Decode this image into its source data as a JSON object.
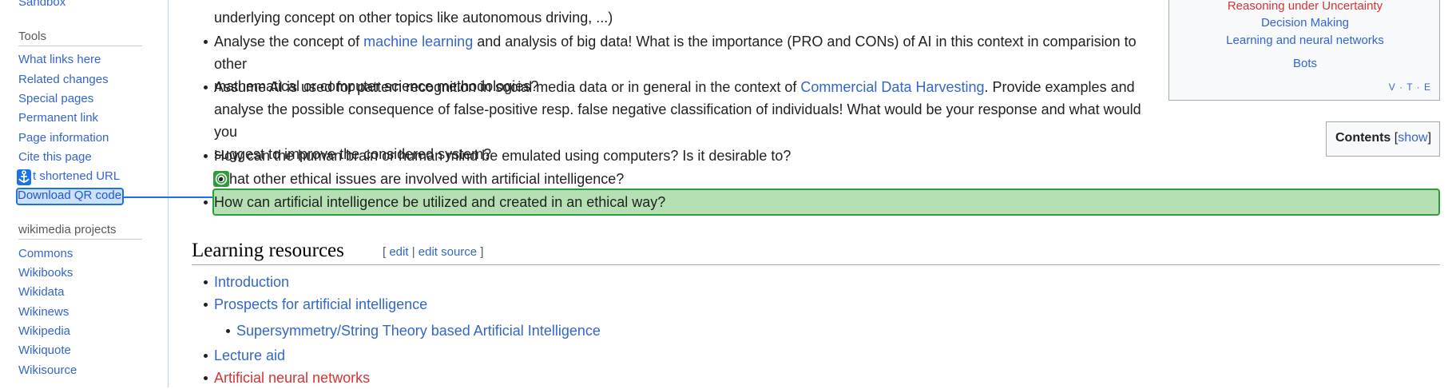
{
  "sidebar": {
    "top_link": "Sandbox",
    "tools_heading": "Tools",
    "tools": [
      "What links here",
      "Related changes",
      "Special pages",
      "Permanent link",
      "Page information",
      "Cite this page",
      "t shortened URL",
      "Download QR code"
    ],
    "projects_heading": "wikimedia projects",
    "projects": [
      "Commons",
      "Wikibooks",
      "Wikidata",
      "Wikinews",
      "Wikipedia",
      "Wikiquote",
      "Wikisource"
    ]
  },
  "questions": {
    "q0_line2": "underlying concept on other topics like autonomous driving, ...)",
    "q1_pre": "Analyse the concept of ",
    "q1_link": "machine learning",
    "q1_post": " and analysis of big data! What is the importance (PRO and CONs) of AI in this context in comparision to other",
    "q1_line2": "mathematical or computer science methodologies?",
    "q2_pre": "Assume AI is used for pattern recognition in social media data or in general in the context of ",
    "q2_link": "Commercial Data Harvesting",
    "q2_post": ". Provide examples and",
    "q2_line2": "analyse the possible consequence of false-positive resp. false negative classification of individuals! What would be your response and what would you",
    "q2_line3": "suggest to improve the considered system?",
    "q3": "How can the human brain or human mind be emulated using computers? Is it desirable to?",
    "q4": "hat other ethical issues are involved with artificial intelligence?",
    "q5": "How can artificial intelligence be utilized and created in an ethical way?"
  },
  "section": {
    "heading": "Learning resources",
    "edit_open": "[ ",
    "edit": "edit",
    "sep": " | ",
    "edit_source": "edit source",
    "edit_close": " ]",
    "items": [
      "Introduction",
      "Prospects for artificial intelligence",
      "Supersymmetry/String Theory based Artificial Intelligence",
      "Lecture aid",
      "Artificial neural networks"
    ]
  },
  "navbox": {
    "item_red": "Reasoning under Uncertainty",
    "items": [
      "Decision Making",
      "Learning and neural networks",
      "Bots"
    ],
    "vte": "V · T · E"
  },
  "toc": {
    "title": "Contents",
    "show_open": "[",
    "show": "show",
    "show_close": "]"
  }
}
